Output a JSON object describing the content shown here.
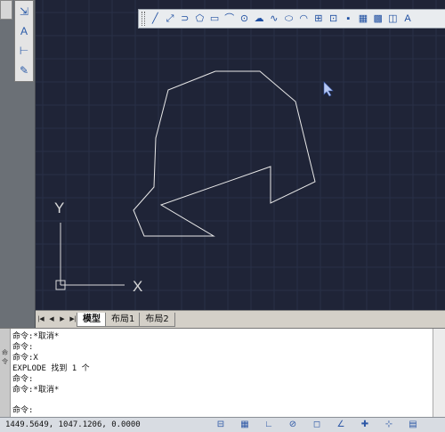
{
  "left_dock": {
    "tools": [
      "pointer-icon",
      "dimension-icon",
      "text-icon",
      "spacing-icon",
      "spacing-icon",
      "brush-icon"
    ]
  },
  "draw_toolbar": {
    "tools": [
      {
        "name": "line-icon",
        "glyph": "╱"
      },
      {
        "name": "construction-line-icon",
        "glyph": "⤢"
      },
      {
        "name": "polyline-icon",
        "glyph": "⊃"
      },
      {
        "name": "polygon-icon",
        "glyph": "⬠"
      },
      {
        "name": "rectangle-icon",
        "glyph": "▭"
      },
      {
        "name": "arc-icon",
        "glyph": "⌒"
      },
      {
        "name": "circle-icon",
        "glyph": "⊙"
      },
      {
        "name": "revision-cloud-icon",
        "glyph": "☁"
      },
      {
        "name": "spline-icon",
        "glyph": "∿"
      },
      {
        "name": "ellipse-icon",
        "glyph": "⬭"
      },
      {
        "name": "ellipse-arc-icon",
        "glyph": "◠"
      },
      {
        "name": "insert-block-icon",
        "glyph": "⊞"
      },
      {
        "name": "make-block-icon",
        "glyph": "⊡"
      },
      {
        "name": "point-icon",
        "glyph": "▪"
      },
      {
        "name": "hatch-icon",
        "glyph": "▦"
      },
      {
        "name": "gradient-icon",
        "glyph": "▩"
      },
      {
        "name": "region-icon",
        "glyph": "◫"
      },
      {
        "name": "mtext-icon",
        "glyph": "A"
      }
    ],
    "close_glyph": "×"
  },
  "ucs": {
    "y_label": "Y",
    "x_label": "X"
  },
  "tabs": {
    "nav": [
      "|◀",
      "◀",
      "▶",
      "▶|"
    ],
    "items": [
      {
        "label": "模型",
        "active": true
      },
      {
        "label": "布局1",
        "active": false
      },
      {
        "label": "布局2",
        "active": false
      }
    ]
  },
  "command": {
    "side_label": "命令",
    "history": [
      "命令:*取消*",
      "命令:",
      "命令:X",
      "EXPLODE 找到 1 个",
      "命令:",
      "命令:*取消*"
    ],
    "prompt": "命令:"
  },
  "status": {
    "coords": "1449.5649, 1047.1206, 0.0000",
    "toggles": [
      {
        "name": "snap-icon",
        "glyph": "⊟"
      },
      {
        "name": "grid-icon",
        "glyph": "▦"
      },
      {
        "name": "ortho-icon",
        "glyph": "∟"
      },
      {
        "name": "polar-icon",
        "glyph": "⊘"
      },
      {
        "name": "osnap-icon",
        "glyph": "◻"
      },
      {
        "name": "otrack-icon",
        "glyph": "∠"
      },
      {
        "name": "ducs-icon",
        "glyph": "✚"
      },
      {
        "name": "dyn-icon",
        "glyph": "⊹"
      },
      {
        "name": "lineweight-icon",
        "glyph": "▤"
      }
    ]
  },
  "colors": {
    "canvas": "#1f2437",
    "geometry": "#e8e8e8",
    "ucs": "#d8d8d8"
  }
}
